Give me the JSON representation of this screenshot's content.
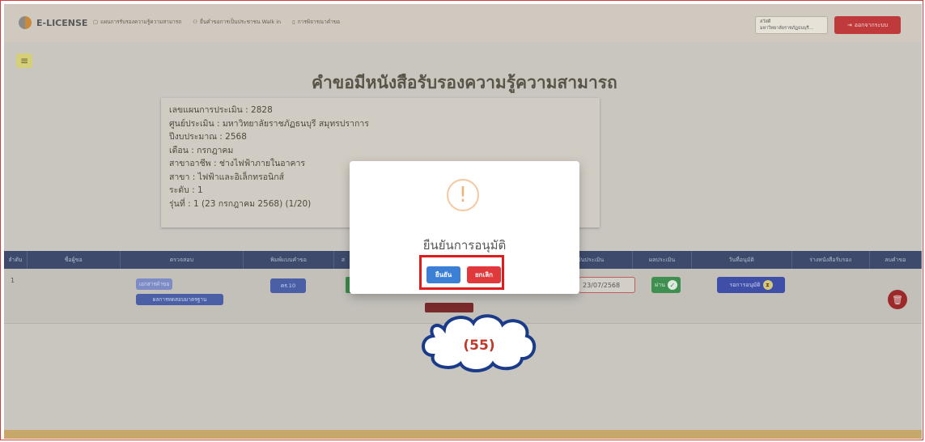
{
  "topbar": {
    "brand": "E-LICENSE",
    "nav": [
      "แผนการรับรองความรู้ความสามารถ",
      "ยื่นคำขอการเป็นประชาชน Walk in",
      "การพิจารณาคำขอ"
    ],
    "user_line1": "สวัสดี",
    "user_line2": "มหาวิทยาลัยราชภัฏธนบุรี...",
    "logout_label": "ออกจากระบบ"
  },
  "page_title": "คำขอมีหนังสือรับรองความรู้ความสามารถ",
  "info": [
    "เลขแผนการประเมิน : 2828",
    "ศูนย์ประเมิน : มหาวิทยาลัยราชภัฏธนบุรี สมุทรปราการ",
    "ปีงบประมาณ : 2568",
    "เดือน : กรกฎาคม",
    "สาขาอาชีพ : ช่างไฟฟ้าภายในอาคาร",
    "สาขา : ไฟฟ้าและอิเล็กทรอนิกส์",
    "ระดับ : 1",
    "รุ่นที่ : 1 (23 กรกฎาคม 2568) (1/20)"
  ],
  "table": {
    "headers": [
      "ลำดับ",
      "ชื่อผู้ขอ",
      "ตรวจสอบ",
      "พิมพ์แบบคำขอ",
      "ส",
      "",
      "วันประเมิน",
      "ผลประเมิน",
      "วันที่อนุมัติ",
      "ร่างหนังสือรับรอง",
      "ลบคำขอ"
    ],
    "row": {
      "index": "1",
      "check_btn1": "เอกสารคำขอ",
      "check_btn2": "ผลการทดสอบมาตรฐาน",
      "print_btn": "คร.10",
      "date": "23/07/2568",
      "result": "ผ่าน",
      "approve_status": "รอการอนุมัติ"
    }
  },
  "modal": {
    "icon": "!",
    "title": "ยืนยันการอนุมัติ",
    "confirm_label": "ยืนยัน",
    "cancel_label": "ยกเลิก"
  },
  "annotation": {
    "label": "(55)"
  },
  "colors": {
    "highlight": "#e01b1b",
    "confirm": "#3b7fd6",
    "cancel": "#e0383b"
  }
}
